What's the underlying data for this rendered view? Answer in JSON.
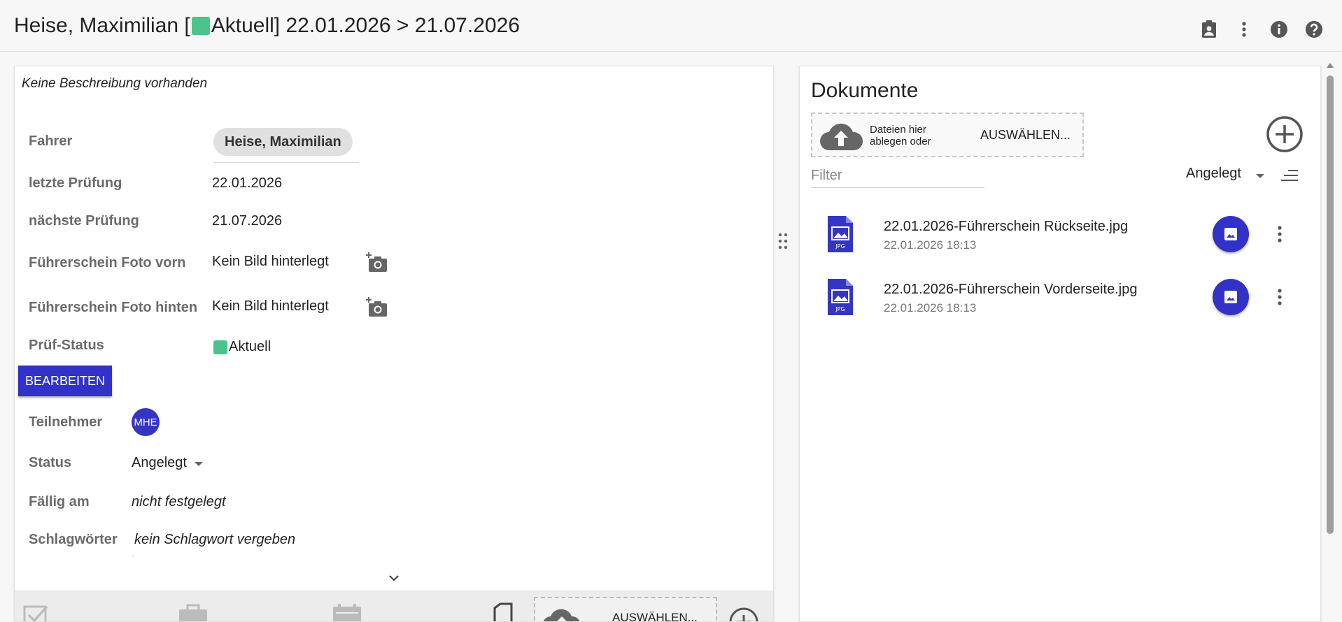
{
  "header": {
    "title_prefix": "Heise, Maximilian [",
    "title_status": "Aktuell",
    "title_suffix": "] 22.01.2026 > 21.07.2026",
    "status_color": "#4cc38a",
    "icons": [
      "assignment-ind-icon",
      "more-vert-icon",
      "info-icon",
      "help-icon"
    ]
  },
  "details": {
    "description": "Keine Beschreibung vorhanden",
    "fields": {
      "driver_label": "Fahrer",
      "driver_value": "Heise, Maximilian",
      "last_check_label": "letzte Prüfung",
      "last_check_value": "22.01.2026",
      "next_check_label": "nächste Prüfung",
      "next_check_value": "21.07.2026",
      "photo_front_label": "Führerschein Foto vorn",
      "photo_front_value": "Kein Bild hinterlegt",
      "photo_back_label": "Führerschein Foto hinten",
      "photo_back_value": "Kein Bild hinterlegt",
      "check_status_label": "Prüf-Status",
      "check_status_value": "Aktuell"
    },
    "edit_button": "BEARBEITEN",
    "participants_label": "Teilnehmer",
    "participant_initials": "MHE",
    "status_label": "Status",
    "status_value": "Angelegt",
    "due_label": "Fällig am",
    "due_value": "nicht festgelegt",
    "tags_label": "Schlagwörter",
    "tags_value": "kein Schlagwort vergeben",
    "bottom_upload_label": "AUSWÄHLEN..."
  },
  "documents": {
    "title": "Dokumente",
    "dropzone_hint": "Dateien hier ablegen oder",
    "dropzone_choose": "AUSWÄHLEN...",
    "filter_placeholder": "Filter",
    "sort_value": "Angelegt",
    "items": [
      {
        "name": "22.01.2026-Führerschein Rückseite.jpg",
        "date": "22.01.2026 18:13",
        "file_type": "JPG"
      },
      {
        "name": "22.01.2026-Führerschein Vorderseite.jpg",
        "date": "22.01.2026 18:13",
        "file_type": "JPG"
      }
    ],
    "accent_color": "#3232c8"
  }
}
